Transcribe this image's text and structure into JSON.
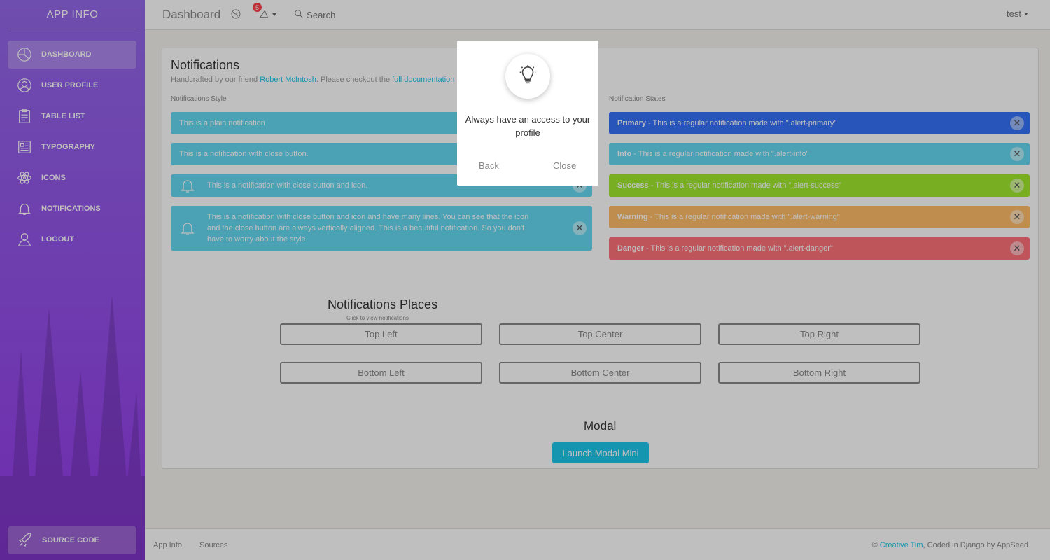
{
  "sidebar": {
    "brand": "APP INFO",
    "items": [
      {
        "label": "DASHBOARD",
        "icon": "chart-pie-icon"
      },
      {
        "label": "USER PROFILE",
        "icon": "user-icon"
      },
      {
        "label": "TABLE LIST",
        "icon": "notes-icon"
      },
      {
        "label": "TYPOGRAPHY",
        "icon": "news-paper-icon"
      },
      {
        "label": "ICONS",
        "icon": "atom-icon"
      },
      {
        "label": "NOTIFICATIONS",
        "icon": "bell-icon"
      },
      {
        "label": "LOGOUT",
        "icon": "logout-user-icon"
      }
    ],
    "source_code": "SOURCE CODE"
  },
  "topbar": {
    "title": "Dashboard",
    "badge_count": "5",
    "search": "Search",
    "user": "test"
  },
  "card": {
    "title": "Notifications",
    "subtitle_prefix": "Handcrafted by our friend ",
    "subtitle_link1": "Robert McIntosh",
    "subtitle_mid": ". Please checkout the ",
    "subtitle_link2": "full documentation",
    "styles_label": "Notifications Style",
    "states_label": "Notification States",
    "style_alerts": [
      "This is a plain notification",
      "This is a notification with close button.",
      "This is a notification with close button and icon.",
      "This is a notification with close button and icon and have many lines. You can see that the icon and the close button are always vertically aligned. This is a beautiful notification. So you don't have to worry about the style."
    ],
    "state_alerts": [
      {
        "strong": "Primary",
        "text": " - This is a regular notification made with \".alert-primary\"",
        "color": "#3472f7"
      },
      {
        "strong": "Info",
        "text": " - This is a regular notification made with \".alert-info\"",
        "color": "#63d8f1"
      },
      {
        "strong": "Success",
        "text": " - This is a regular notification made with \".alert-success\"",
        "color": "#a1e82c"
      },
      {
        "strong": "Warning",
        "text": " - This is a regular notification made with \".alert-warning\"",
        "color": "#ffbc67"
      },
      {
        "strong": "Danger",
        "text": " - This is a regular notification made with \".alert-danger\"",
        "color": "#fc727a"
      }
    ],
    "places_title": "Notifications Places",
    "places_sub": "Click to view notifications",
    "places_buttons": [
      "Top Left",
      "Top Center",
      "Top Right",
      "Bottom Left",
      "Bottom Center",
      "Bottom Right"
    ],
    "modal_title": "Modal",
    "launch_button": "Launch Modal Mini"
  },
  "footer": {
    "link1": "App Info",
    "link2": "Sources",
    "copyright": "© ",
    "creator": "Creative Tim",
    "coded": ", Coded in Django by AppSeed"
  },
  "dialog": {
    "icon": "bulb-icon",
    "message": "Always have an access to your profile",
    "back": "Back",
    "close": "Close"
  }
}
